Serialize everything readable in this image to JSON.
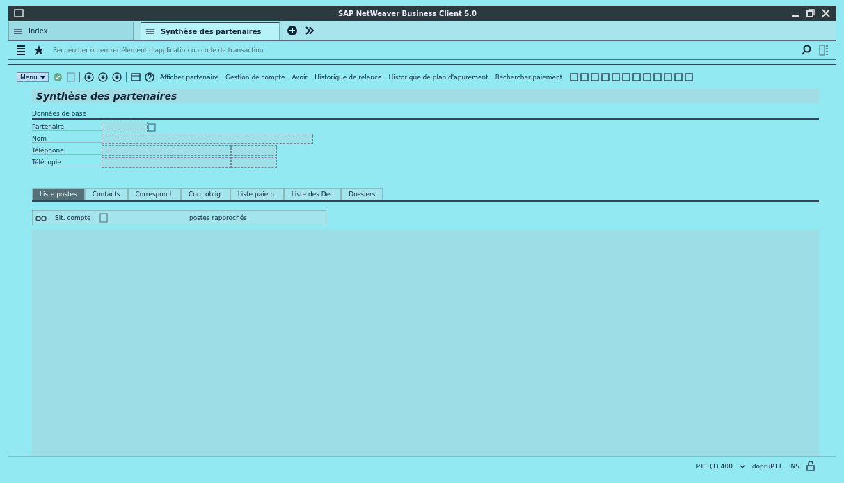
{
  "window": {
    "title": "SAP NetWeaver Business Client 5.0"
  },
  "tabs": [
    {
      "label": "Index",
      "selected": false
    },
    {
      "label": "Synthèse des partenaires",
      "selected": true
    }
  ],
  "search": {
    "placeholder": "Rechercher ou entrer élément d'application ou code de transaction"
  },
  "toolbar": {
    "menu": "Menu",
    "actions": [
      "Afficher partenaire",
      "Gestion de compte",
      "Avoir",
      "Historique de relance",
      "Historique de plan d'apurement",
      "Rechercher paiement"
    ]
  },
  "page_title": "Synthèse des partenaires",
  "section": "Données de base",
  "fields": [
    {
      "label": "Partenaire",
      "kind": "lookup"
    },
    {
      "label": "Nom",
      "kind": "wide"
    },
    {
      "label": "Téléphone",
      "kind": "split"
    },
    {
      "label": "Télécopie",
      "kind": "split"
    }
  ],
  "detail_tabs": [
    {
      "label": "Liste postes",
      "selected": true
    },
    {
      "label": "Contacts",
      "selected": false
    },
    {
      "label": "Correspond.",
      "selected": false
    },
    {
      "label": "Corr. oblig.",
      "selected": false
    },
    {
      "label": "Liste paiem.",
      "selected": false
    },
    {
      "label": "Liste des Dec",
      "selected": false
    },
    {
      "label": "Dossiers",
      "selected": false
    }
  ],
  "detail_buttons": [
    "Sit. compte",
    "postes rapprochés"
  ],
  "status_bar": {
    "system": "PT1 (1) 400",
    "user": "dopruPT1",
    "mode": "INS"
  }
}
